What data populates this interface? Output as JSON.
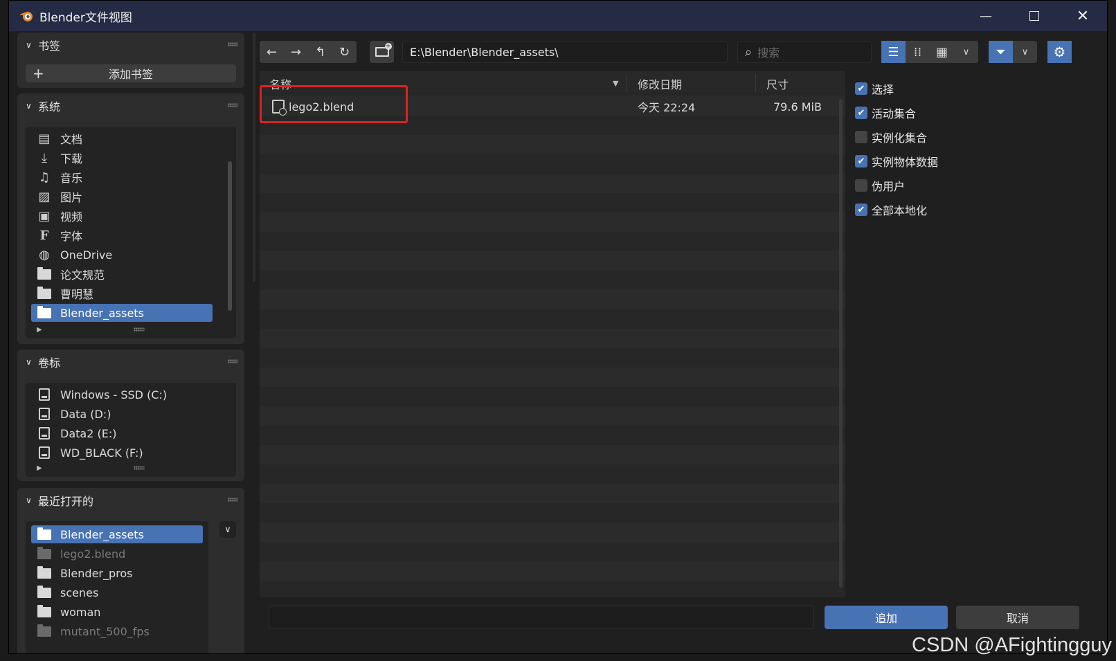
{
  "window": {
    "title": "Blender文件视图"
  },
  "bookmarks": {
    "header": "书签",
    "add_label": "添加书签"
  },
  "system": {
    "header": "系统",
    "items": [
      {
        "label": "文档"
      },
      {
        "label": "下载"
      },
      {
        "label": "音乐"
      },
      {
        "label": "图片"
      },
      {
        "label": "视频"
      },
      {
        "label": "字体"
      },
      {
        "label": "OneDrive"
      },
      {
        "label": "论文规范"
      },
      {
        "label": "曹明慧"
      },
      {
        "label": "Blender_assets"
      }
    ]
  },
  "volumes": {
    "header": "卷标",
    "items": [
      {
        "label": "Windows - SSD (C:)"
      },
      {
        "label": "Data (D:)"
      },
      {
        "label": "Data2 (E:)"
      },
      {
        "label": "WD_BLACK (F:)"
      }
    ]
  },
  "recent": {
    "header": "最近打开的",
    "items": [
      {
        "label": "Blender_assets"
      },
      {
        "label": "lego2.blend"
      },
      {
        "label": "Blender_pros"
      },
      {
        "label": "scenes"
      },
      {
        "label": "woman"
      },
      {
        "label": "mutant_500_fps"
      }
    ]
  },
  "toolbar": {
    "path": "E:\\Blender\\Blender_assets\\",
    "search_placeholder": "搜索"
  },
  "file_list": {
    "columns": {
      "name": "名称",
      "date": "修改日期",
      "size": "尺寸"
    },
    "files": [
      {
        "name": "lego2.blend",
        "date": "今天 22:24",
        "size": "79.6 MiB"
      }
    ]
  },
  "options": [
    {
      "label": "选择",
      "checked": true
    },
    {
      "label": "活动集合",
      "checked": true
    },
    {
      "label": "实例化集合",
      "checked": false
    },
    {
      "label": "实例物体数据",
      "checked": true
    },
    {
      "label": "伪用户",
      "checked": false
    },
    {
      "label": "全部本地化",
      "checked": true
    }
  ],
  "footer": {
    "confirm_label": "追加",
    "cancel_label": "取消"
  },
  "watermark": "CSDN @AFightingguy",
  "colors": {
    "accent": "#4772b3",
    "highlight_box": "#e02020",
    "titlebar": "#252a45"
  }
}
